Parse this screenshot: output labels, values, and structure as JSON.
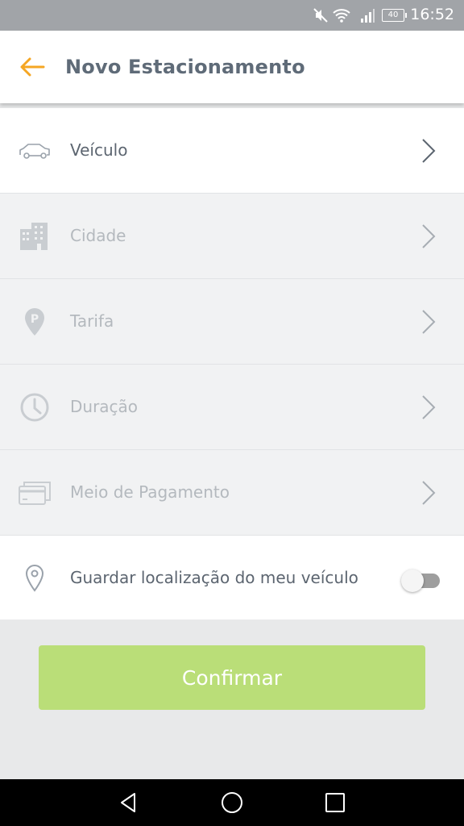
{
  "status_bar": {
    "time": "16:52",
    "battery": "40",
    "icons": [
      "mute-icon",
      "wifi-icon",
      "signal-icon",
      "battery-icon"
    ]
  },
  "app_bar": {
    "title": "Novo Estacionamento",
    "back_icon": "arrow-left-icon",
    "accent_color": "#f5a623"
  },
  "list": {
    "items": [
      {
        "label": "Veículo",
        "icon": "car-icon",
        "enabled": true
      },
      {
        "label": "Cidade",
        "icon": "building-icon",
        "enabled": false
      },
      {
        "label": "Tarifa",
        "icon": "parking-pin-icon",
        "enabled": false
      },
      {
        "label": "Duração",
        "icon": "clock-icon",
        "enabled": false
      },
      {
        "label": "Meio de Pagamento",
        "icon": "credit-card-icon",
        "enabled": false
      }
    ],
    "toggle": {
      "label": "Guardar localização do meu veículo",
      "icon": "location-pin-icon",
      "on": false
    }
  },
  "confirm": {
    "label": "Confirmar",
    "color": "#bade78"
  },
  "nav_bar": {
    "icons": [
      "back-triangle-icon",
      "home-circle-icon",
      "recents-square-icon"
    ]
  }
}
